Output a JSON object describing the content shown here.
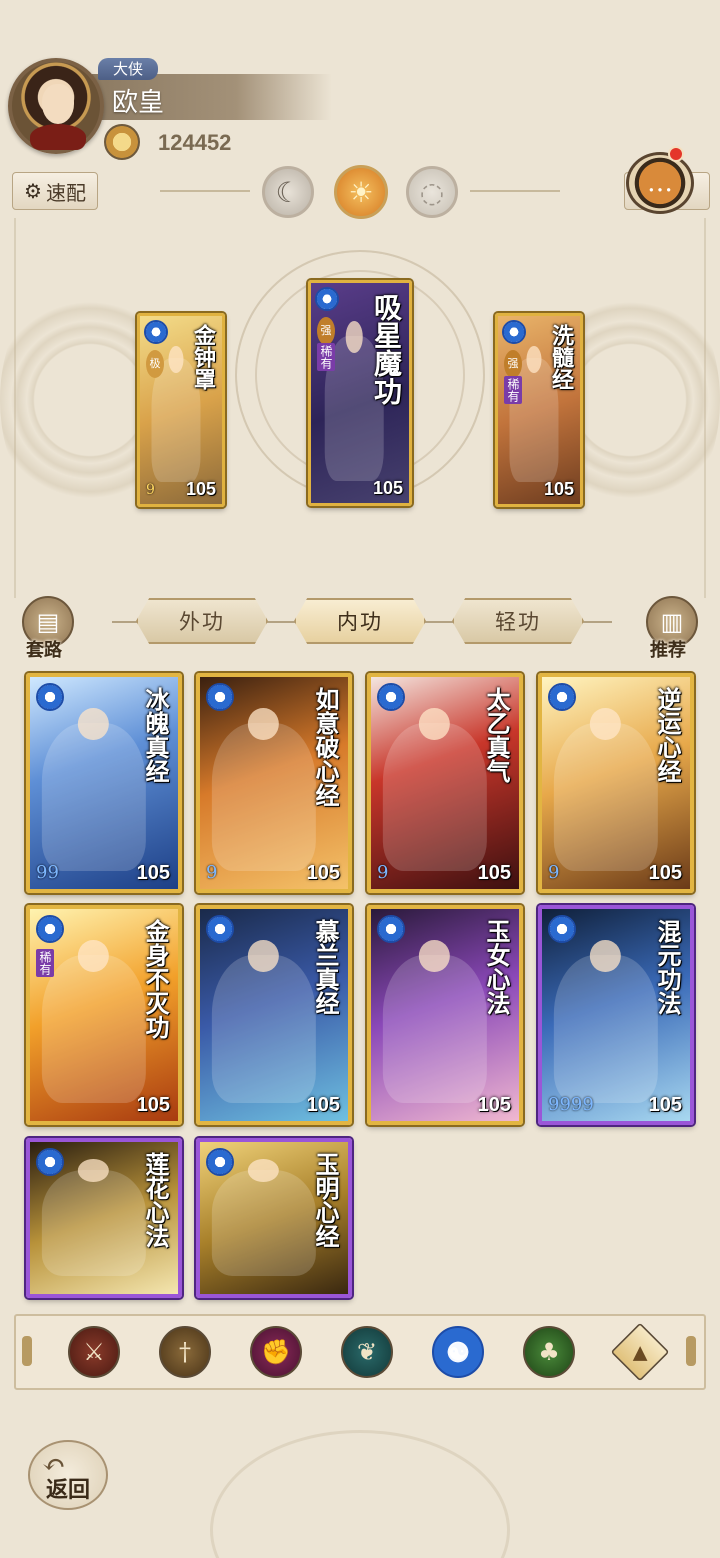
{
  "player": {
    "title_badge": "大侠",
    "name": "欧皇",
    "coins": "124452"
  },
  "toolbar": {
    "quick_config_label": "速配",
    "mode_icons": [
      "moon-icon",
      "sun-icon",
      "ring-icon"
    ],
    "chat_icon": "chat-bubble-icon"
  },
  "equipped": [
    {
      "title": "金钟罩",
      "tag": "极",
      "level": "105",
      "drops": "9"
    },
    {
      "title": "吸星魔功",
      "tag": "强",
      "rarity": "稀有",
      "level": "105",
      "drops": ""
    },
    {
      "title": "洗髓经",
      "tag": "强",
      "rarity": "稀有",
      "level": "105",
      "drops": ""
    }
  ],
  "tabs": {
    "left_side": "套路",
    "waigong": "外功",
    "neigong": "内功",
    "qinggong": "轻功",
    "right_side": "推荐",
    "active": "内功"
  },
  "cards": [
    {
      "title": "冰魄真经",
      "level": "105",
      "drops": "99",
      "frame": "gold"
    },
    {
      "title": "如意破心经",
      "level": "105",
      "drops": "9",
      "frame": "gold"
    },
    {
      "title": "太乙真气",
      "level": "105",
      "drops": "9",
      "frame": "gold"
    },
    {
      "title": "逆运心经",
      "level": "105",
      "drops": "9",
      "frame": "gold"
    },
    {
      "title": "金身不灭功",
      "level": "105",
      "drops": "",
      "rarity": "稀有",
      "frame": "gold"
    },
    {
      "title": "慕兰真经",
      "level": "105",
      "drops": "",
      "frame": "gold"
    },
    {
      "title": "玉女心法",
      "level": "105",
      "drops": "",
      "frame": "gold"
    },
    {
      "title": "混元功法",
      "level": "105",
      "drops": "9999",
      "frame": "purple"
    },
    {
      "title": "莲花心法",
      "level": "",
      "drops": "",
      "frame": "purple"
    },
    {
      "title": "玉明心经",
      "level": "",
      "drops": "",
      "frame": "purple"
    }
  ],
  "filters": [
    "sword-icon",
    "dagger-icon",
    "fist-icon",
    "fan-icon",
    "taiji-icon",
    "gourd-icon",
    "up-arrow-icon"
  ],
  "back_label": "返回",
  "colors": {
    "gold_frame": "#e2b542",
    "purple_frame": "#9a56d8",
    "background": "#ece4d4"
  }
}
